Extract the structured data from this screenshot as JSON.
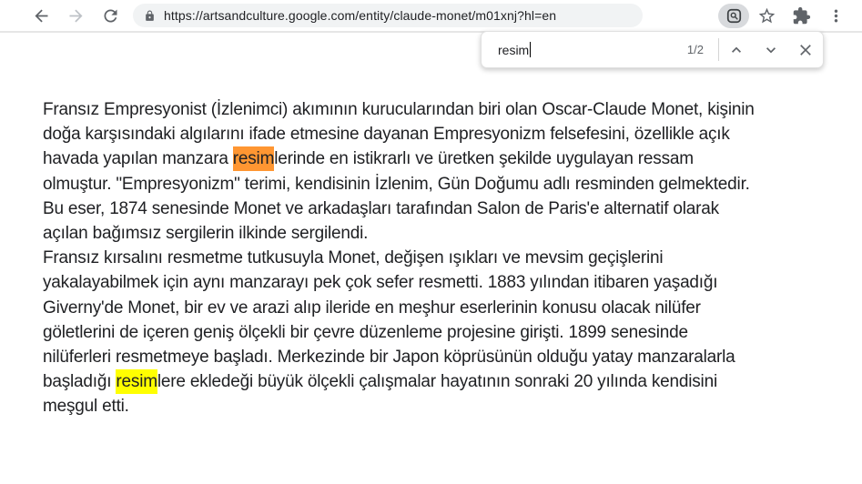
{
  "browser": {
    "url": "https://artsandculture.google.com/entity/claude-monet/m01xnj?hl=en"
  },
  "find_bar": {
    "query": "resim",
    "match_count": "1/2"
  },
  "colors": {
    "active_highlight": "#ff9632",
    "other_highlight": "#ffff00"
  },
  "content": {
    "lines": [
      {
        "segments": [
          {
            "text": "Fransız Empresyonist (İzlenimci) akımının kurucularından biri olan Oscar-Claude Monet, kişinin"
          }
        ]
      },
      {
        "segments": [
          {
            "text": "doğa karşısındaki algılarını ifade etmesine dayanan Empresyonizm felsefesini, özellikle açık"
          }
        ]
      },
      {
        "segments": [
          {
            "text": "havada yapılan manzara "
          },
          {
            "text": "resim",
            "highlight": "active"
          },
          {
            "text": "lerinde en istikrarlı ve üretken şekilde uygulayan ressam"
          }
        ]
      },
      {
        "segments": [
          {
            "text": "olmuştur. \"Empresyonizm\" terimi, kendisinin İzlenim, Gün Doğumu adlı resminden gelmektedir."
          }
        ]
      },
      {
        "segments": [
          {
            "text": "Bu eser, 1874 senesinde Monet ve arkadaşları tarafından Salon de Paris'e alternatif olarak"
          }
        ]
      },
      {
        "segments": [
          {
            "text": "açılan bağımsız sergilerin ilkinde sergilendi."
          }
        ]
      },
      {
        "segments": [
          {
            "text": "Fransız kırsalını resmetme tutkusuyla Monet, değişen ışıkları ve mevsim geçişlerini"
          }
        ]
      },
      {
        "segments": [
          {
            "text": "yakalayabilmek için aynı manzarayı pek çok sefer resmetti. 1883 yılından itibaren yaşadığı"
          }
        ]
      },
      {
        "segments": [
          {
            "text": "Giverny'de Monet, bir ev ve arazi alıp ileride en meşhur eserlerinin konusu olacak nilüfer"
          }
        ]
      },
      {
        "segments": [
          {
            "text": "göletlerini de içeren geniş ölçekli bir çevre düzenleme projesine girişti. 1899 senesinde"
          }
        ]
      },
      {
        "segments": [
          {
            "text": "nilüferleri resmetmeye başladı. Merkezinde bir Japon köprüsünün olduğu yatay manzaralarla"
          }
        ]
      },
      {
        "segments": [
          {
            "text": "başladığı "
          },
          {
            "text": "resim",
            "highlight": "match"
          },
          {
            "text": "lere ekledeği büyük ölçekli çalışmalar hayatının sonraki 20 yılında kendisini"
          }
        ]
      },
      {
        "segments": [
          {
            "text": "meşgul etti."
          }
        ]
      }
    ]
  }
}
